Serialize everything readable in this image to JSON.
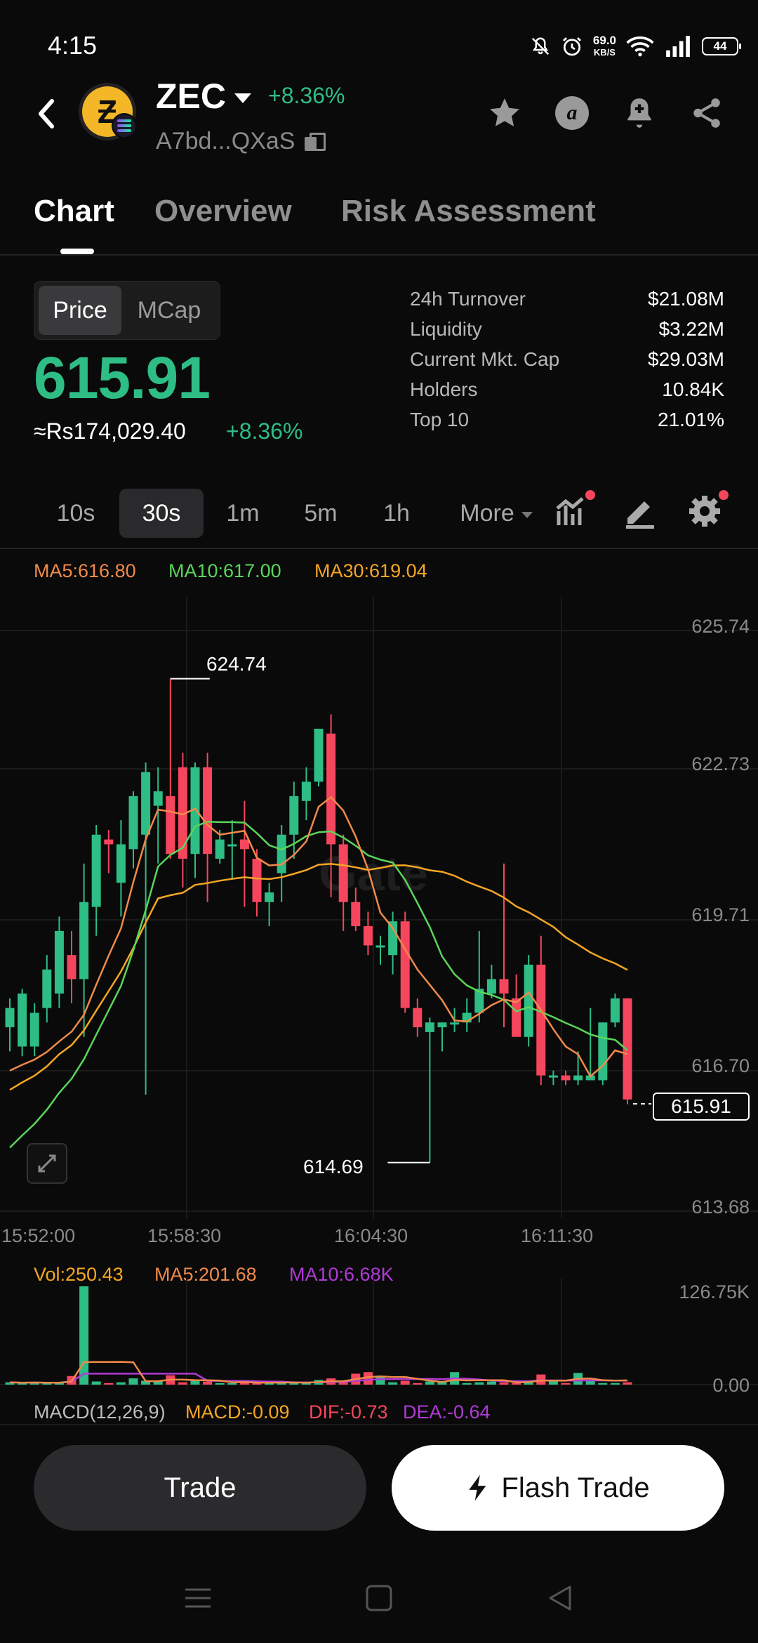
{
  "status_bar": {
    "time": "4:15",
    "net_speed": "69.0",
    "net_unit": "KB/S",
    "battery": "44"
  },
  "header": {
    "symbol": "ZEC",
    "change": "+8.36%",
    "address": "A7bd...QXaS",
    "icons": [
      "back-icon",
      "star-icon",
      "alpha-icon",
      "bell-plus-icon",
      "share-icon"
    ]
  },
  "tabs": [
    {
      "label": "Chart",
      "active": true
    },
    {
      "label": "Overview",
      "active": false
    },
    {
      "label": "Risk Assessment",
      "active": false
    }
  ],
  "price_panel": {
    "toggle": [
      "Price",
      "MCap"
    ],
    "price": "615.91",
    "fiat": "≈Rs174,029.40",
    "fiat_change": "+8.36%",
    "stats": [
      {
        "label": "24h Turnover",
        "value": "$21.08M"
      },
      {
        "label": "Liquidity",
        "value": "$3.22M"
      },
      {
        "label": "Current Mkt. Cap",
        "value": "$29.03M"
      },
      {
        "label": "Holders",
        "value": "10.84K"
      },
      {
        "label": "Top 10",
        "value": "21.01%"
      }
    ]
  },
  "timeframes": [
    {
      "label": "10s",
      "active": false
    },
    {
      "label": "30s",
      "active": true
    },
    {
      "label": "1m",
      "active": false
    },
    {
      "label": "5m",
      "active": false
    },
    {
      "label": "1h",
      "active": false
    },
    {
      "label": "More",
      "active": false
    }
  ],
  "colors": {
    "up": "#2ebd85",
    "down": "#f6465d",
    "ma5": "#f08a4b",
    "ma10": "#5ad65a",
    "ma30": "#f5a623",
    "vol_ma10": "#b03ad6"
  },
  "chart_data": {
    "type": "candlestick",
    "legend": {
      "ma5": "MA5:616.80",
      "ma10": "MA10:617.00",
      "ma30": "MA30:619.04"
    },
    "y_ticks": [
      "625.74",
      "622.73",
      "619.71",
      "616.70",
      "613.68"
    ],
    "ylim": [
      613.68,
      625.74
    ],
    "x_ticks": [
      "15:52:00",
      "15:58:30",
      "16:04:30",
      "16:11:30"
    ],
    "high_label": "624.74",
    "low_label": "614.69",
    "last_price_label": "615.91",
    "candles": [
      [
        617.5,
        617.9,
        618.1,
        617.0
      ],
      [
        617.1,
        618.2,
        618.3,
        616.9
      ],
      [
        617.1,
        617.8,
        618.0,
        616.9
      ],
      [
        617.9,
        618.7,
        619.0,
        617.6
      ],
      [
        618.2,
        619.5,
        619.8,
        617.9
      ],
      [
        619.0,
        618.5,
        619.5,
        618.0
      ],
      [
        618.5,
        620.1,
        620.9,
        617.3
      ],
      [
        620.0,
        621.5,
        621.7,
        619.4
      ],
      [
        621.4,
        621.3,
        621.6,
        620.7
      ],
      [
        620.5,
        621.3,
        621.8,
        619.8
      ],
      [
        621.2,
        622.3,
        622.4,
        620.8
      ],
      [
        621.5,
        622.8,
        623.0,
        616.1
      ],
      [
        622.1,
        622.4,
        622.9,
        620.9
      ],
      [
        622.3,
        621.1,
        624.74,
        621.0
      ],
      [
        622.9,
        621.0,
        623.2,
        620.4
      ],
      [
        621.1,
        622.9,
        623.0,
        620.6
      ],
      [
        622.9,
        621.1,
        623.2,
        620.1
      ],
      [
        621.0,
        621.4,
        621.6,
        620.9
      ],
      [
        621.3,
        621.3,
        621.8,
        620.6
      ],
      [
        621.4,
        621.2,
        622.2,
        620.0
      ],
      [
        621.0,
        620.1,
        621.2,
        619.8
      ],
      [
        620.1,
        620.3,
        620.5,
        619.6
      ],
      [
        620.7,
        621.5,
        621.7,
        620.1
      ],
      [
        621.5,
        622.3,
        622.6,
        621.0
      ],
      [
        622.2,
        622.6,
        622.9,
        621.8
      ],
      [
        622.6,
        623.7,
        623.7,
        622.5
      ],
      [
        623.6,
        621.3,
        624.0,
        620.2
      ],
      [
        621.3,
        620.1,
        621.5,
        619.5
      ],
      [
        620.1,
        619.6,
        620.4,
        619.5
      ],
      [
        619.6,
        619.2,
        619.9,
        619.0
      ],
      [
        619.2,
        619.2,
        619.4,
        618.8
      ],
      [
        619.0,
        619.7,
        619.9,
        618.6
      ],
      [
        619.7,
        617.9,
        619.9,
        617.8
      ],
      [
        617.9,
        617.5,
        618.1,
        617.3
      ],
      [
        617.4,
        617.6,
        617.7,
        614.69
      ],
      [
        617.5,
        617.6,
        617.6,
        617.0
      ],
      [
        617.6,
        617.6,
        617.9,
        617.4
      ],
      [
        617.6,
        617.8,
        618.1,
        617.4
      ],
      [
        617.8,
        618.3,
        619.5,
        617.6
      ],
      [
        618.2,
        618.5,
        618.8,
        618.1
      ],
      [
        618.5,
        618.2,
        620.9,
        617.5
      ],
      [
        618.1,
        617.3,
        618.6,
        617.3
      ],
      [
        617.3,
        618.8,
        619.0,
        617.1
      ],
      [
        618.8,
        616.5,
        619.4,
        616.3
      ],
      [
        616.5,
        616.5,
        616.6,
        616.3
      ],
      [
        616.5,
        616.4,
        616.6,
        616.3
      ],
      [
        616.4,
        616.5,
        617.0,
        616.3
      ],
      [
        616.4,
        616.5,
        617.9,
        616.4
      ],
      [
        616.4,
        617.6,
        617.6,
        616.3
      ],
      [
        617.6,
        618.1,
        618.2,
        617.5
      ],
      [
        618.1,
        616.0,
        618.1,
        615.9
      ]
    ],
    "volume": {
      "legend": {
        "vol": "Vol:250.43",
        "ma5": "MA5:201.68",
        "ma10": "MA10:6.68K"
      },
      "y_ticks": [
        "126.75K",
        "0.00"
      ],
      "values": [
        3,
        2,
        3,
        2,
        2,
        11,
        126,
        4,
        2,
        3,
        8,
        5,
        4,
        12,
        3,
        5,
        4,
        2,
        1,
        4,
        2,
        3,
        3,
        2,
        2,
        6,
        8,
        4,
        14,
        16,
        11,
        3,
        5,
        2,
        4,
        3,
        16,
        2,
        3,
        4,
        3,
        2,
        4,
        13,
        4,
        2,
        15,
        5,
        2,
        2,
        3
      ]
    },
    "macd_legend": {
      "title": "MACD(12,26,9)",
      "macd": "MACD:-0.09",
      "dif": "DIF:-0.73",
      "dea": "DEA:-0.64"
    }
  },
  "buttons": {
    "trade": "Trade",
    "flash_trade": "Flash Trade"
  }
}
